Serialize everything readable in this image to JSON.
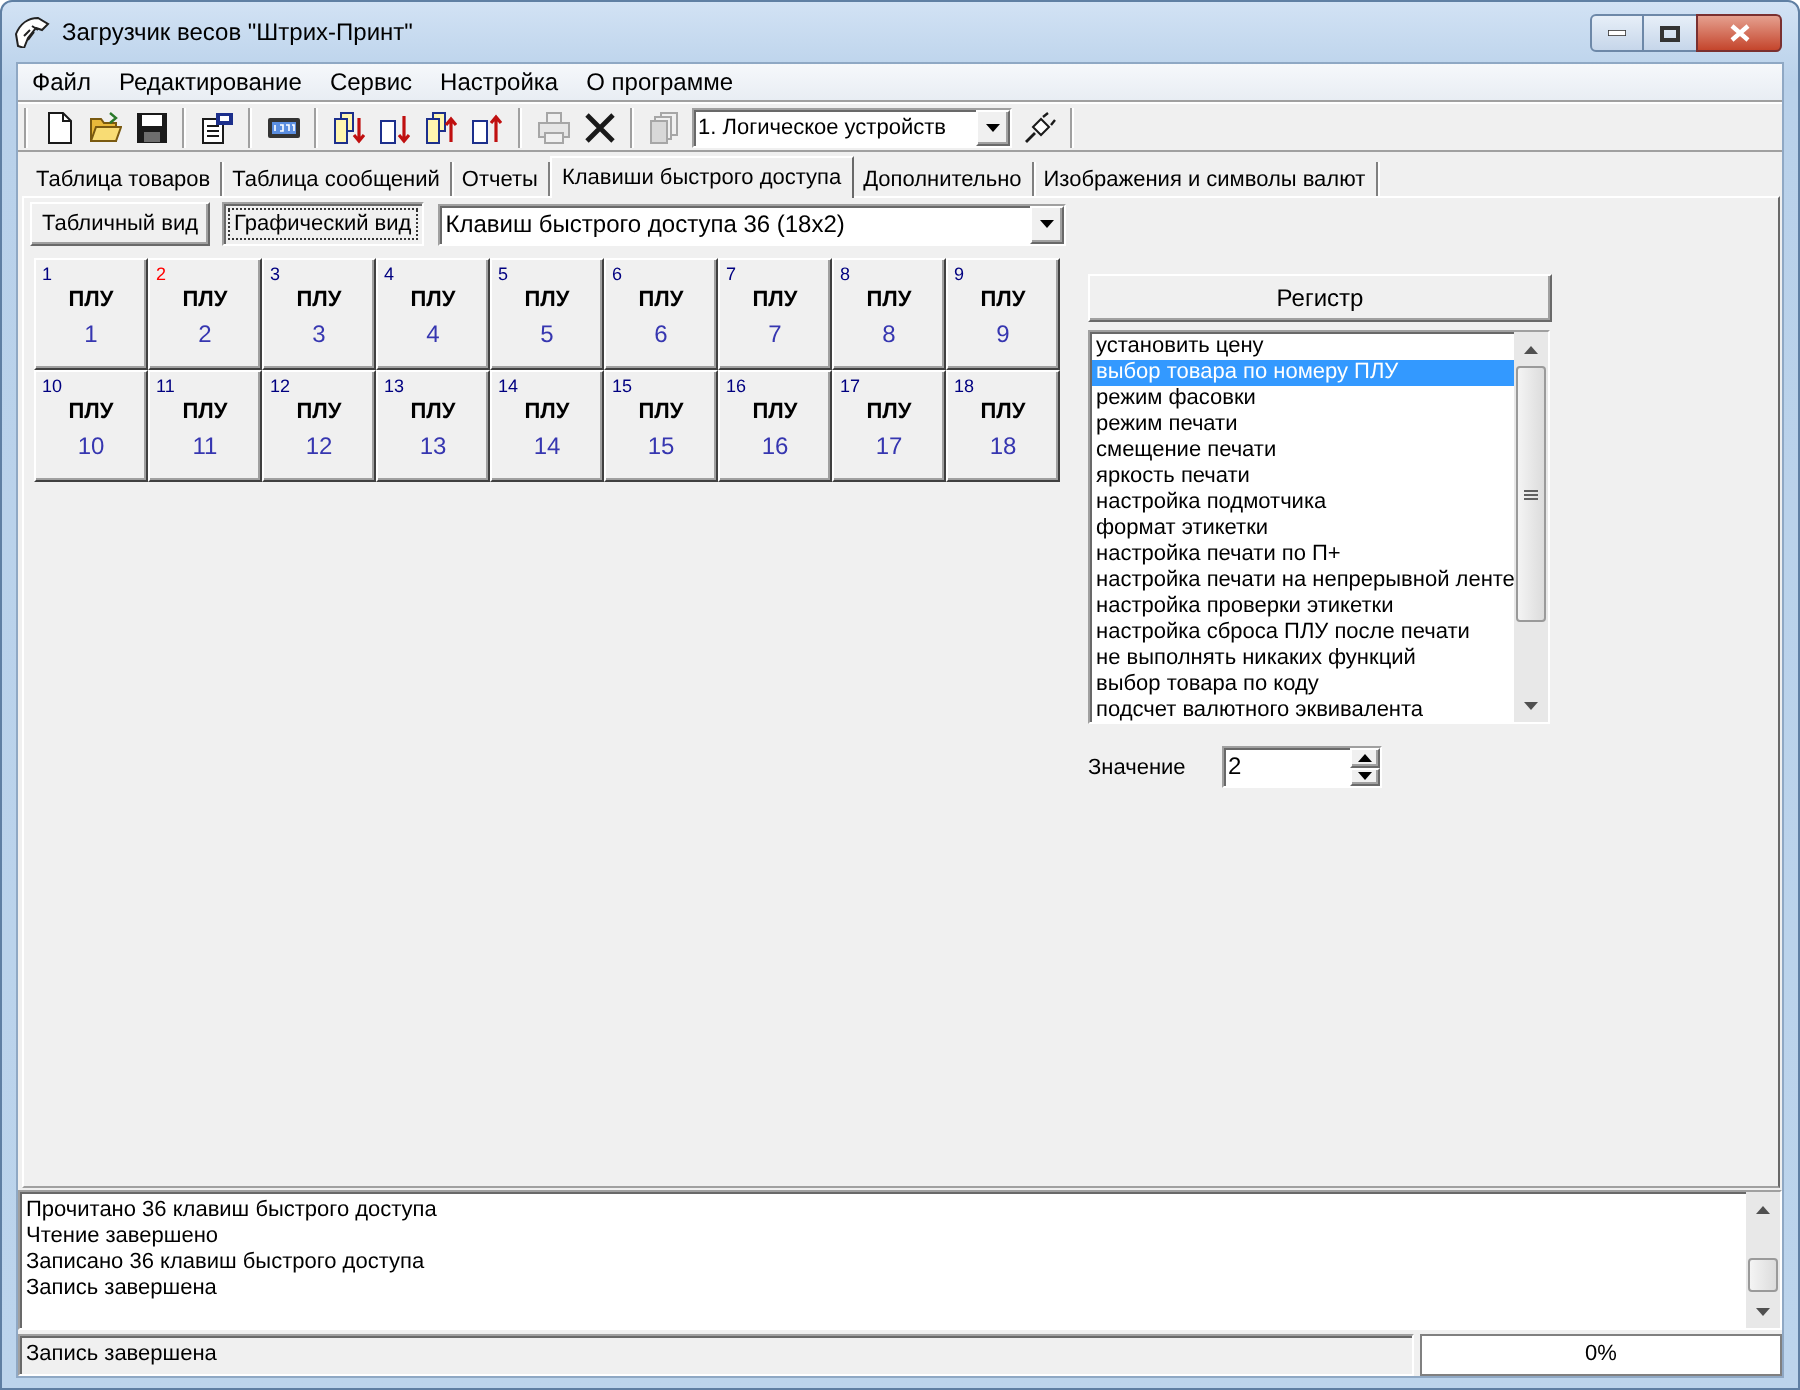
{
  "window": {
    "title": "Загрузчик весов \"Штрих-Принт\""
  },
  "menu": [
    "Файл",
    "Редактирование",
    "Сервис",
    "Настройка",
    "О программе"
  ],
  "toolbar": {
    "groups": [
      {
        "items": [
          {
            "kind": "new",
            "disabled": false
          },
          {
            "kind": "open",
            "disabled": false
          },
          {
            "kind": "save",
            "disabled": false
          }
        ]
      },
      {
        "items": [
          {
            "kind": "properties",
            "disabled": false
          }
        ]
      },
      {
        "items": [
          {
            "kind": "display",
            "disabled": false
          }
        ]
      },
      {
        "items": [
          {
            "kind": "read_all",
            "disabled": false
          },
          {
            "kind": "read",
            "disabled": false
          },
          {
            "kind": "write_all",
            "disabled": false
          },
          {
            "kind": "write",
            "disabled": false
          }
        ]
      },
      {
        "items": [
          {
            "kind": "print",
            "disabled": true
          },
          {
            "kind": "delete",
            "disabled": false
          }
        ]
      },
      {
        "items": [
          {
            "kind": "copy",
            "disabled": true
          },
          {
            "kind": "select",
            "value": "1. Логическое устройств"
          },
          {
            "kind": "connect",
            "disabled": false
          }
        ]
      }
    ]
  },
  "tabs": [
    {
      "label": "Таблица товаров",
      "selected": false
    },
    {
      "label": "Таблица сообщений",
      "selected": false
    },
    {
      "label": "Отчеты",
      "selected": false
    },
    {
      "label": "Клавиши быстрого доступа",
      "selected": true
    },
    {
      "label": "Дополнительно",
      "selected": false
    },
    {
      "label": "Изображения и символы валют",
      "selected": false
    }
  ],
  "view_buttons": [
    {
      "label": "Табличный вид",
      "selected": false
    },
    {
      "label": "Графический вид",
      "selected": true
    }
  ],
  "layout_select": {
    "value": "Клавиш быстрого доступа 36 (18x2)"
  },
  "keys": [
    {
      "index": "1",
      "caption": "ПЛУ",
      "number": "1",
      "selected": false
    },
    {
      "index": "2",
      "caption": "ПЛУ",
      "number": "2",
      "selected": true
    },
    {
      "index": "3",
      "caption": "ПЛУ",
      "number": "3",
      "selected": false
    },
    {
      "index": "4",
      "caption": "ПЛУ",
      "number": "4",
      "selected": false
    },
    {
      "index": "5",
      "caption": "ПЛУ",
      "number": "5",
      "selected": false
    },
    {
      "index": "6",
      "caption": "ПЛУ",
      "number": "6",
      "selected": false
    },
    {
      "index": "7",
      "caption": "ПЛУ",
      "number": "7",
      "selected": false
    },
    {
      "index": "8",
      "caption": "ПЛУ",
      "number": "8",
      "selected": false
    },
    {
      "index": "9",
      "caption": "ПЛУ",
      "number": "9",
      "selected": false
    },
    {
      "index": "10",
      "caption": "ПЛУ",
      "number": "10",
      "selected": false
    },
    {
      "index": "11",
      "caption": "ПЛУ",
      "number": "11",
      "selected": false
    },
    {
      "index": "12",
      "caption": "ПЛУ",
      "number": "12",
      "selected": false
    },
    {
      "index": "13",
      "caption": "ПЛУ",
      "number": "13",
      "selected": false
    },
    {
      "index": "14",
      "caption": "ПЛУ",
      "number": "14",
      "selected": false
    },
    {
      "index": "15",
      "caption": "ПЛУ",
      "number": "15",
      "selected": false
    },
    {
      "index": "16",
      "caption": "ПЛУ",
      "number": "16",
      "selected": false
    },
    {
      "index": "17",
      "caption": "ПЛУ",
      "number": "17",
      "selected": false
    },
    {
      "index": "18",
      "caption": "ПЛУ",
      "number": "18",
      "selected": false
    }
  ],
  "register_button": {
    "label": "Регистр"
  },
  "functions": [
    {
      "label": "установить цену",
      "selected": false
    },
    {
      "label": "выбор товара по номеру ПЛУ",
      "selected": true
    },
    {
      "label": "режим фасовки",
      "selected": false
    },
    {
      "label": "режим печати",
      "selected": false
    },
    {
      "label": "смещение печати",
      "selected": false
    },
    {
      "label": "яркость печати",
      "selected": false
    },
    {
      "label": "настройка подмотчика",
      "selected": false
    },
    {
      "label": "формат этикетки",
      "selected": false
    },
    {
      "label": "настройка печати по П+",
      "selected": false
    },
    {
      "label": "настройка печати на непрерывной ленте",
      "selected": false
    },
    {
      "label": "настройка проверки этикетки",
      "selected": false
    },
    {
      "label": "настройка сброса ПЛУ после печати",
      "selected": false
    },
    {
      "label": "не выполнять никаких функций",
      "selected": false
    },
    {
      "label": "выбор товара по коду",
      "selected": false
    },
    {
      "label": "подсчет валютного эквивалента",
      "selected": false
    }
  ],
  "value_field": {
    "label": "Значение",
    "value": "2"
  },
  "log": [
    "Прочитано 36 клавиш быстрого доступа",
    "Чтение завершено",
    "Записано 36 клавиш быстрого доступа",
    "Запись завершена"
  ],
  "status_bar": {
    "message": "Запись завершена",
    "progress": "0%"
  }
}
